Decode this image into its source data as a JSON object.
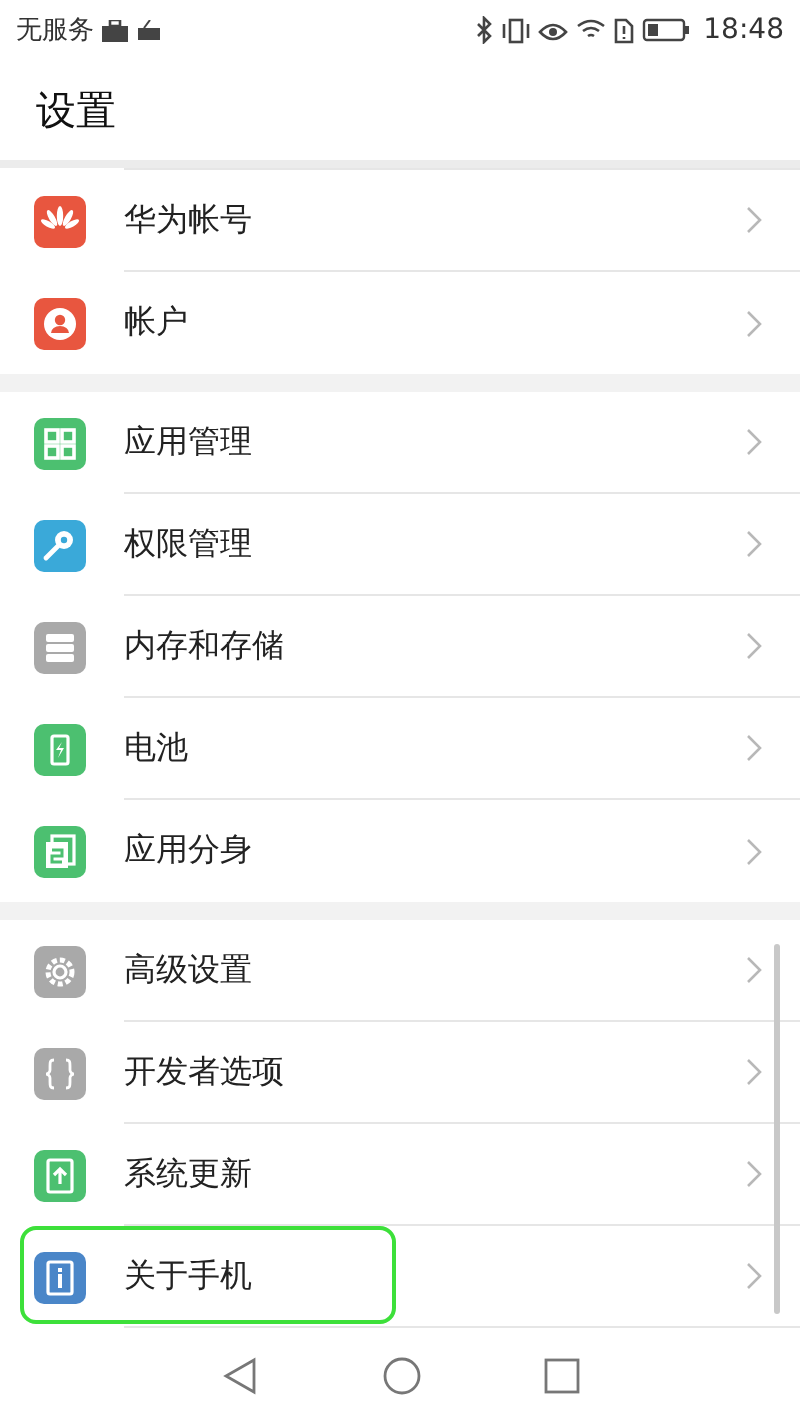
{
  "status_bar": {
    "carrier": "无服务",
    "time": "18:48"
  },
  "header": {
    "title": "设置"
  },
  "groups": [
    {
      "items": [
        {
          "label": "华为帐号",
          "kind": "huawei",
          "highlighted": false
        },
        {
          "label": "帐户",
          "kind": "account",
          "highlighted": false
        }
      ]
    },
    {
      "items": [
        {
          "label": "应用管理",
          "kind": "apps",
          "highlighted": false
        },
        {
          "label": "权限管理",
          "kind": "key",
          "highlighted": false
        },
        {
          "label": "内存和存储",
          "kind": "storage",
          "highlighted": false
        },
        {
          "label": "电池",
          "kind": "battery",
          "highlighted": false
        },
        {
          "label": "应用分身",
          "kind": "twin",
          "highlighted": false
        }
      ]
    },
    {
      "items": [
        {
          "label": "高级设置",
          "kind": "gear",
          "highlighted": false
        },
        {
          "label": "开发者选项",
          "kind": "braces",
          "highlighted": false
        },
        {
          "label": "系统更新",
          "kind": "update",
          "highlighted": false
        },
        {
          "label": "关于手机",
          "kind": "info",
          "highlighted": true
        }
      ]
    }
  ]
}
